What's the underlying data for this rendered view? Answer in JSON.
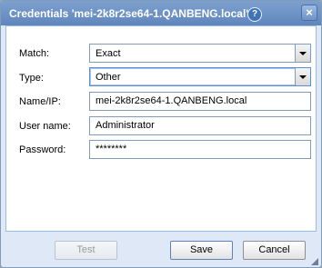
{
  "window": {
    "title": "Credentials 'mei-2k8r2se64-1.QANBENG.local'",
    "help_glyph": "?",
    "close_glyph": "×"
  },
  "form": {
    "match": {
      "label": "Match:",
      "value": "Exact"
    },
    "type": {
      "label": "Type:",
      "value": "Other"
    },
    "name_ip": {
      "label": "Name/IP:",
      "value": "mei-2k8r2se64-1.QANBENG.local"
    },
    "user_name": {
      "label": "User name:",
      "value": "Administrator"
    },
    "password": {
      "label": "Password:",
      "value": "********"
    }
  },
  "buttons": {
    "test": "Test",
    "save": "Save",
    "cancel": "Cancel"
  },
  "colors": {
    "titlebar": "#6b8fc4",
    "dialog_bg": "#dfe8f6",
    "field_border": "#7f9db9"
  },
  "icons": [
    "help-icon",
    "close-icon",
    "dropdown-arrow-icon",
    "resize-grip-icon"
  ]
}
